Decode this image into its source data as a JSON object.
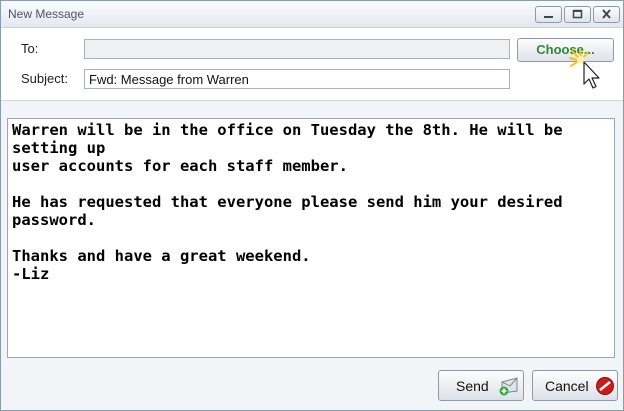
{
  "window": {
    "title": "New Message"
  },
  "header": {
    "to_label": "To:",
    "to_value": "",
    "subject_label": "Subject:",
    "subject_value": "Fwd: Message from Warren",
    "choose_label": "Choose..."
  },
  "message": {
    "text": "Warren will be in the office on Tuesday the 8th. He will be setting up\nuser accounts for each staff member.\n\nHe has requested that everyone please send him your desired\npassword.\n\nThanks and have a great weekend.\n-Liz"
  },
  "footer": {
    "send_label": "Send",
    "cancel_label": "Cancel"
  },
  "icons": {
    "minimize": "minimize-icon",
    "maximize": "maximize-icon",
    "close": "close-icon",
    "send": "send-icon",
    "cancel": "cancel-icon",
    "cursor": "mouse-pointer-icon"
  },
  "colors": {
    "choose_text": "#2f8a2f",
    "cancel_icon": "#d01818"
  }
}
